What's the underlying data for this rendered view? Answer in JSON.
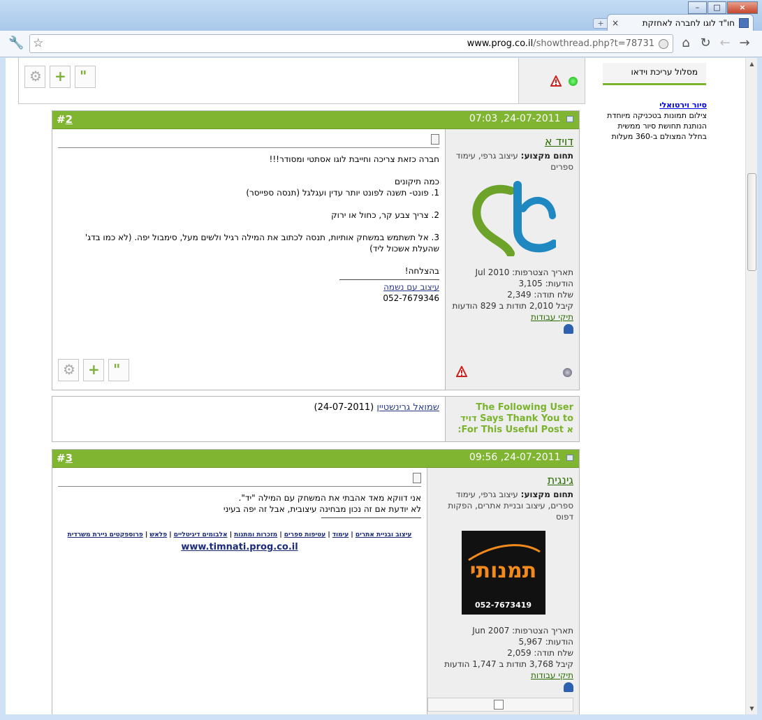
{
  "window": {
    "tab_title": "חו\"ד לוגו לחברה לאחזקת",
    "tab_close": "×",
    "new_tab": "+",
    "minimize": "–",
    "maximize": "□",
    "close": "×"
  },
  "toolbar": {
    "url_host": "www.prog.co.il",
    "url_path": "/showthread.php?t=78731"
  },
  "sidebar": {
    "menu_item": "מסלול עריכת וידאו",
    "virtual_tour_link": "סיור וירטואלי",
    "virtual_tour_text": "צילום תמונות בטכניקה מיוחדת הנותנת תחושת סיור ממשית בחלל המצולם ב-360 מעלות"
  },
  "post2": {
    "date": "24-07-2011, 07:03",
    "number_prefix": "#",
    "number": "2",
    "username": "דויד א",
    "field_label": "תחום מקצוע:",
    "field_value": "עיצוב גרפי, עימוד ספרים",
    "stats": {
      "joined": "תאריך הצטרפות: Jul 2010",
      "posts": "הודעות: 3,105",
      "thanks_sent": "שלח תודה: 2,349",
      "thanks_received": "קיבל 2,010 תודות ב 829 הודעות",
      "portfolio": "תיקי עבודות"
    },
    "message": {
      "line1": "חברה כזאת צריכה וחייבת לוגו אסתטי ומסודר!!!",
      "line2": "כמה תיקונים",
      "line3": "1. פונט- תשנה לפונט יותר עדין ועגלגל (תנסה ספייסר)",
      "line4": "2. צריך צבע קר, כחול או ירוק",
      "line5": "3. אל תשתמש במשחק אותיות, תנסה לכתוב את המילה רגיל ולשים מעל, סימבול יפה. (לא כמו בדג' שהעלת אשכול ליד)",
      "line6": "בהצלחה!",
      "sig_link": "עיצוב עם נשמה",
      "sig_phone": "052-7679346"
    }
  },
  "thanks": {
    "label": "The Following User Says Thank You to דויד א For This Useful Post:",
    "user": "שמואל גרינשטיין",
    "date": "(24-07-2011)"
  },
  "post3": {
    "date": "24-07-2011, 09:56",
    "number_prefix": "#",
    "number": "3",
    "username": "גינגית",
    "field_label": "תחום מקצוע:",
    "field_value": "עיצוב גרפי, עימוד ספרים, עיצוב ובניית אתרים, הפקות דפוס",
    "stats": {
      "joined": "תאריך הצטרפות: Jun 2007",
      "posts": "הודעות: 5,967",
      "thanks_sent": "שלח תודה: 2,059",
      "thanks_received": "קיבל 3,768 תודות ב 1,747 הודעות",
      "portfolio": "תיקי עבודות"
    },
    "message": {
      "line1": "אני דווקא מאד אהבתי את המשחק עם המילה \"יד\".",
      "line2": "לא יודעת אם זה נכון מבחינה עיצובית, אבל זה יפה בעיני",
      "sig_links": [
        "עיצוב ובניית אתרים",
        "עימוד",
        "עטיפות ספרים",
        "מזכרות ומתנות",
        "אלבומים דיגיטליים",
        "פלאש",
        "פרוספקטים ניירת משרדית"
      ],
      "sig_site": "www.timnati.prog.co.il"
    },
    "avatar_text": "תמנותי",
    "avatar_phone": "052-7673419"
  },
  "colors": {
    "post_header": "#80b532",
    "username": "#2a6c00",
    "link": "#2a3b8c"
  }
}
